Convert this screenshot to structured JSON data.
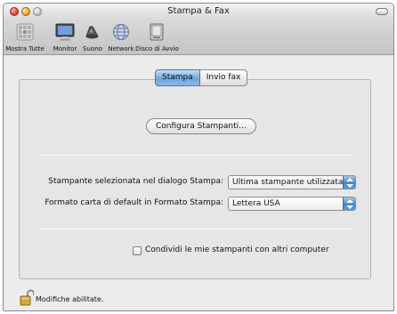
{
  "window": {
    "title": "Stampa & Fax"
  },
  "toolbar": {
    "items": [
      {
        "label": "Mostra Tutte",
        "icon": "apple-grid-icon"
      },
      {
        "label": "Monitor",
        "icon": "monitor-icon"
      },
      {
        "label": "Suono",
        "icon": "speaker-icon"
      },
      {
        "label": "Network",
        "icon": "network-globe-icon"
      },
      {
        "label": "Disco di Avvio",
        "icon": "startup-disk-icon"
      }
    ]
  },
  "tabs": [
    {
      "label": "Stampa",
      "selected": true
    },
    {
      "label": "Invio fax",
      "selected": false
    }
  ],
  "configure_button": "Configura Stampanti...",
  "selected_printer": {
    "label": "Stampante selezionata nel dialogo Stampa:",
    "value": "Ultima stampante utilizzata"
  },
  "paper_format": {
    "label": "Formato carta di default in Formato Stampa:",
    "value": "Lettera USA"
  },
  "share_checkbox": {
    "label": "Condividi le mie stampanti con altri computer",
    "checked": false
  },
  "footer": {
    "status": "Modifiche abilitate.",
    "icon": "lock-open-icon"
  },
  "colors": {
    "accent": "#4f8fd6"
  }
}
